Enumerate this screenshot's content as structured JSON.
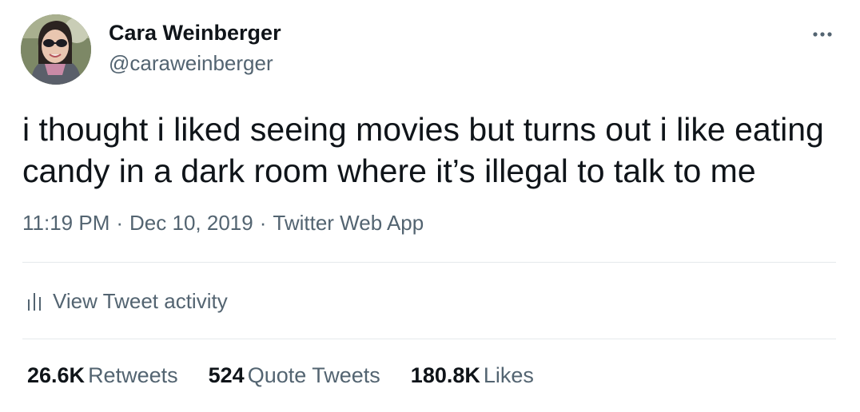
{
  "author": {
    "name": "Cara Weinberger",
    "handle": "@caraweinberger",
    "avatar_icon": "profile-photo-icon"
  },
  "more_icon": "ellipsis-icon",
  "tweet": {
    "text": "i thought i liked seeing movies but turns out i like eating candy in a dark room where it’s illegal to talk to me"
  },
  "meta": {
    "time": "11:19 PM",
    "date": "Dec 10, 2019",
    "separator": "·",
    "source": "Twitter Web App"
  },
  "activity": {
    "label": "View Tweet activity",
    "icon": "analytics-bars-icon"
  },
  "stats": {
    "retweets_count": "26.6K",
    "retweets_label": "Retweets",
    "quotes_count": "524",
    "quotes_label": "Quote Tweets",
    "likes_count": "180.8K",
    "likes_label": "Likes"
  },
  "colors": {
    "text_primary": "#0f1419",
    "text_secondary": "#536471",
    "divider": "#e5e9ec"
  }
}
